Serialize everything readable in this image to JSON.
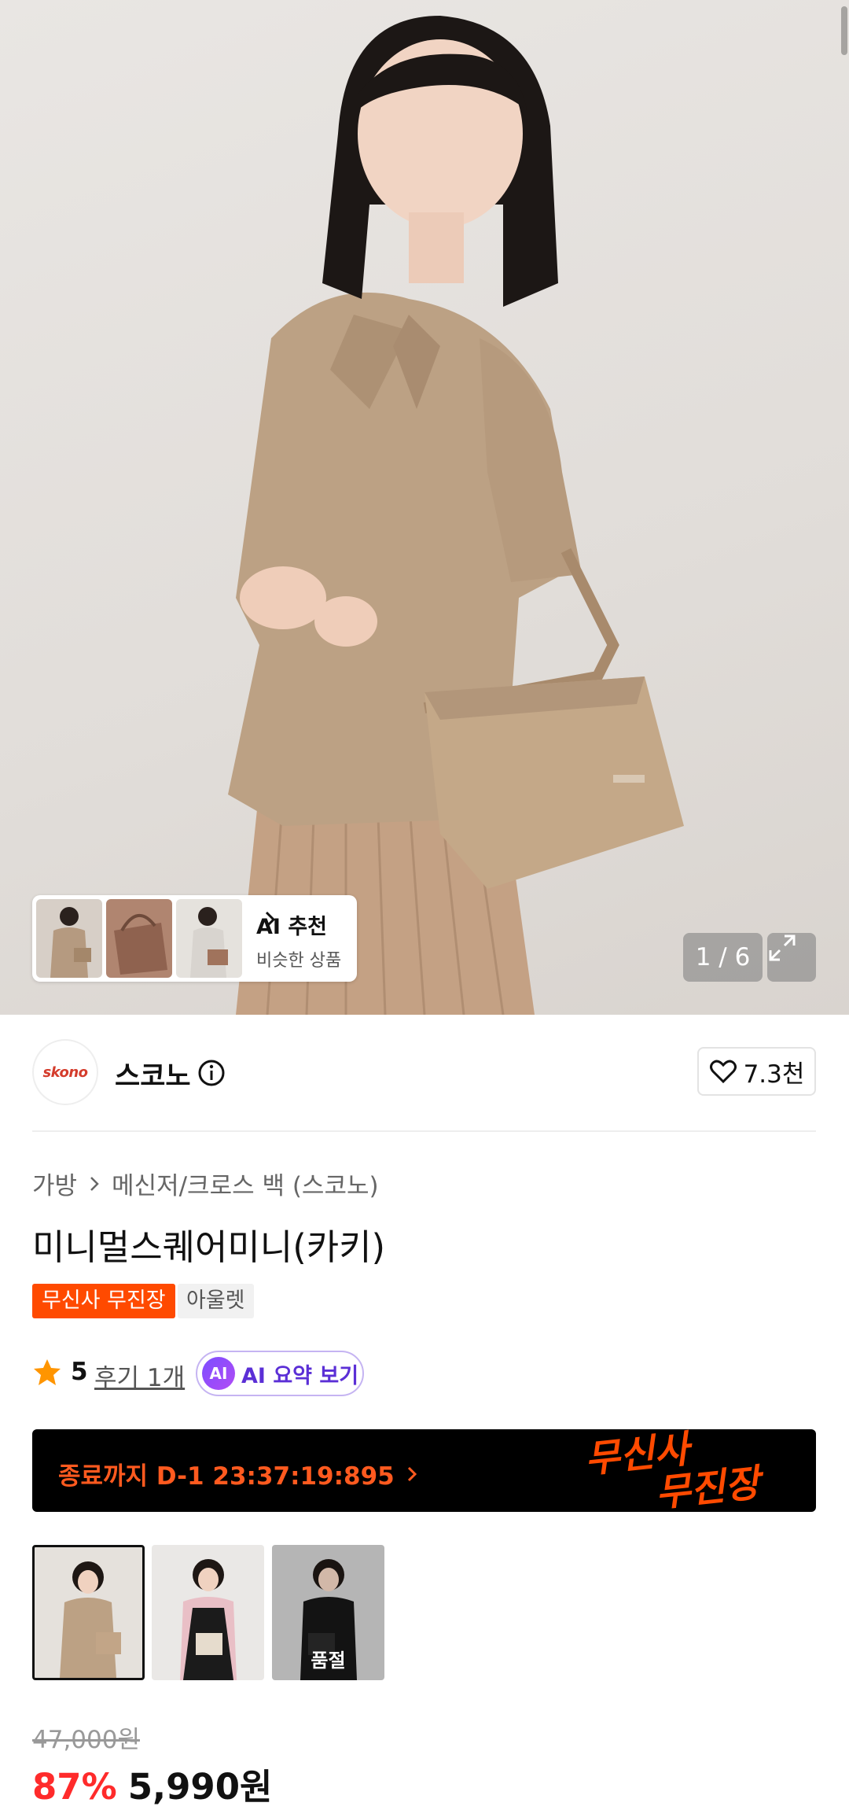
{
  "hero": {
    "ai_recommend_title": "AI 추천",
    "ai_recommend_sub": "비슷한 상품",
    "counter": "1 / 6"
  },
  "brand": {
    "logo_text": "skono",
    "name": "스코노",
    "likes": "7.3천"
  },
  "product": {
    "breadcrumb": [
      "가방",
      "메신저/크로스 백 (스코노)"
    ],
    "title": "미니멀스퀘어미니(카키)",
    "tags": [
      "무신사 무진장",
      "아울렛"
    ],
    "rating": "5",
    "reviews": "후기 1개",
    "ai_summary_badge": "AI",
    "ai_summary": "AI 요약 보기"
  },
  "promo": {
    "countdown": "종료까지 D-1 23:37:19:895",
    "logo_text_1": "무신사",
    "logo_text_2": "무진장"
  },
  "options": {
    "soldout_label": "품절"
  },
  "price": {
    "original": "47,000원",
    "discount": "87%",
    "final": "5,990원"
  },
  "colors": {
    "accent_orange": "#ff4a00",
    "discount_red": "#ff2b2b",
    "ai_purple": "#5b2fd6"
  }
}
